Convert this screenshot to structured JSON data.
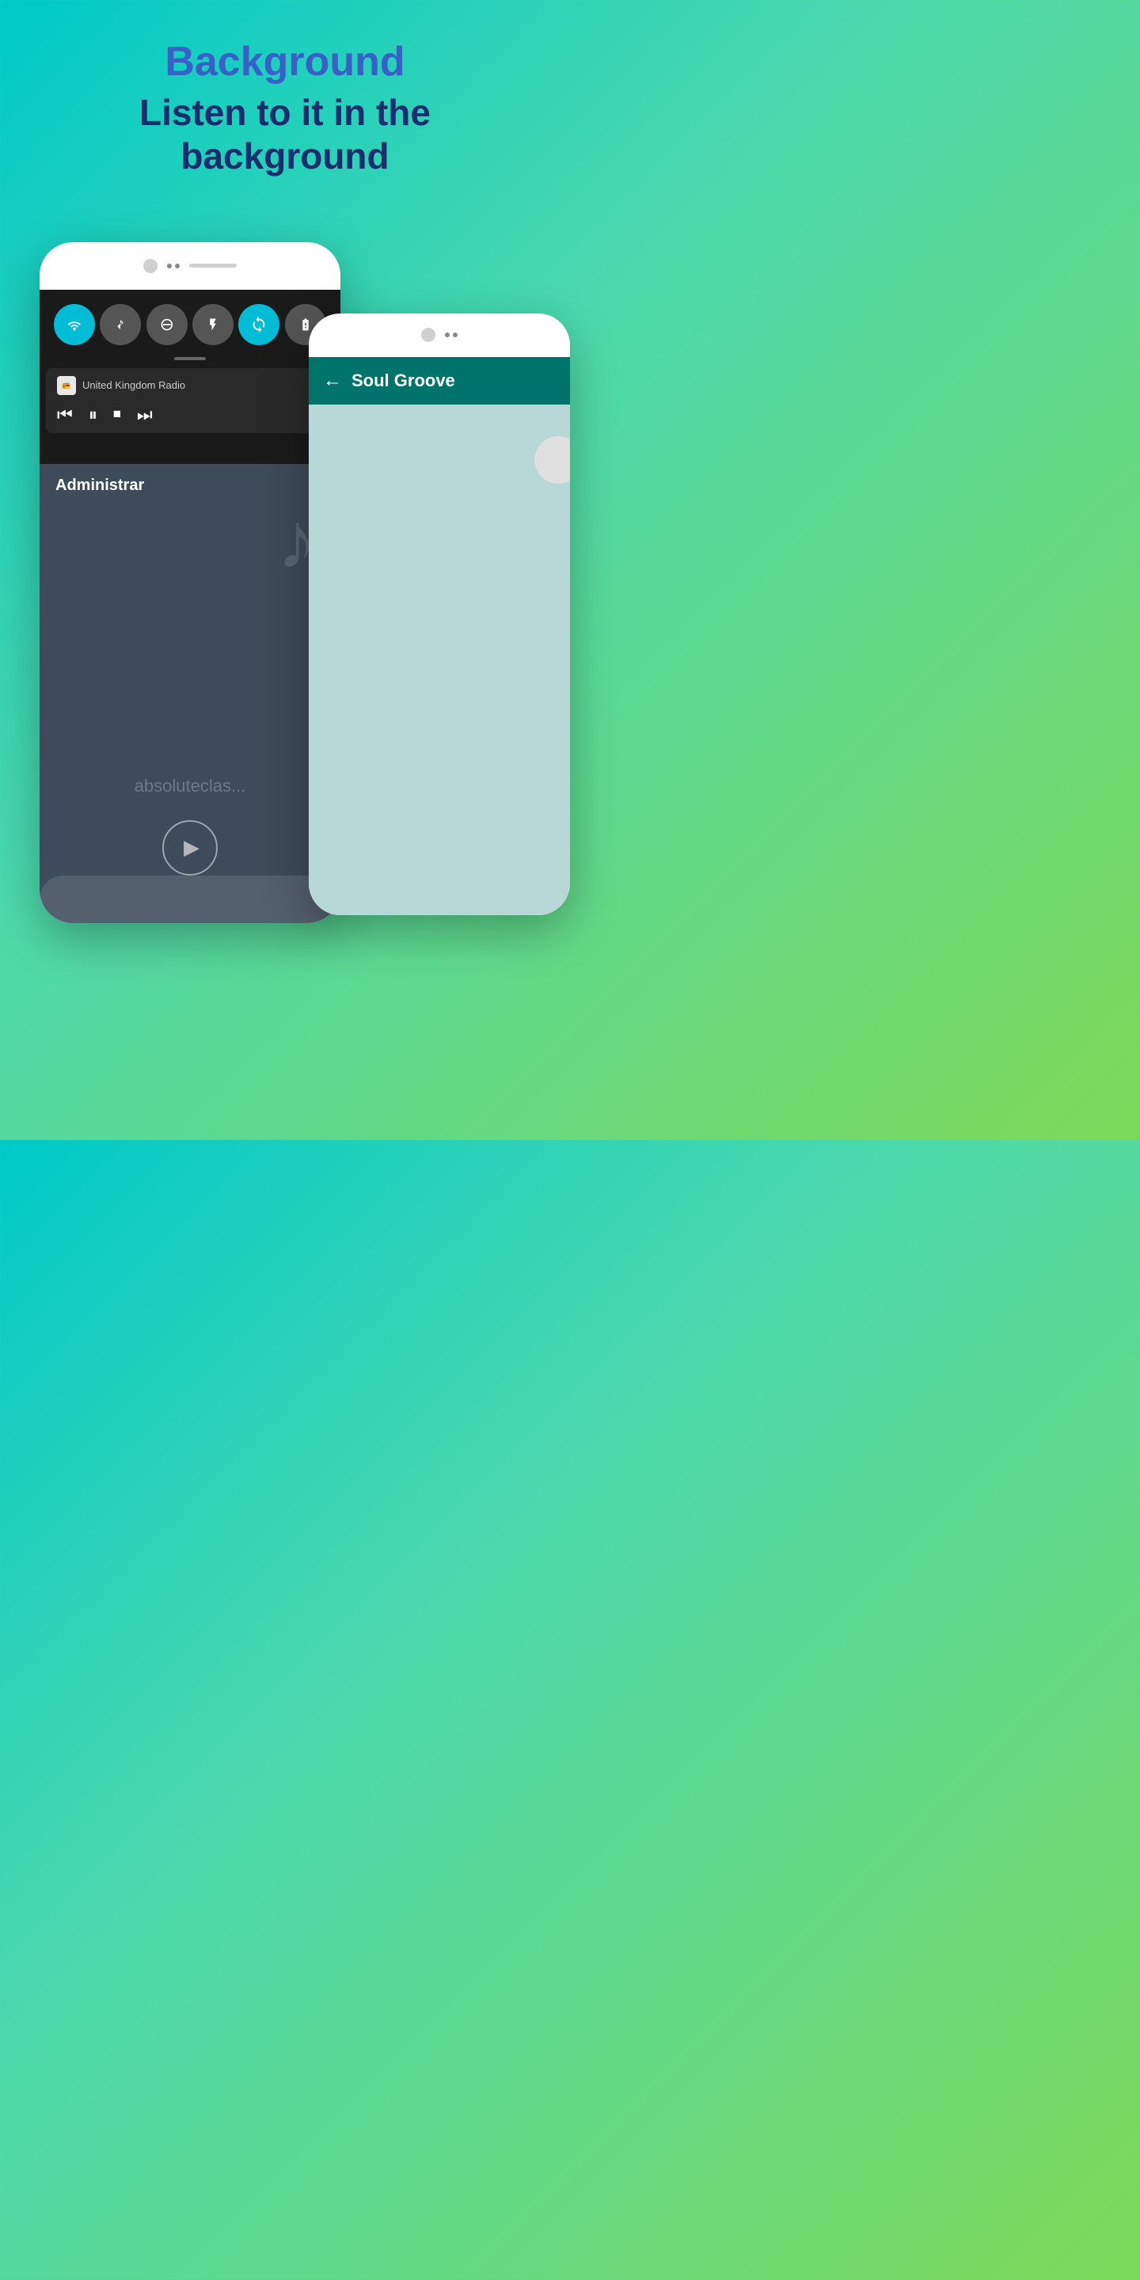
{
  "header": {
    "title": "Background",
    "subtitle_line1": "Listen to it in the",
    "subtitle_line2": "background"
  },
  "phone_left": {
    "media_app_name": "United Kingdom Radio",
    "manage_label": "Administrar",
    "watermark": "absoluteclas...",
    "controls": {
      "prev": "⏮",
      "pause": "⏸",
      "stop": "⏹",
      "next": "⏭"
    }
  },
  "phone_right": {
    "station_name": "Soul Groove",
    "back_arrow": "←"
  },
  "quick_icons": [
    {
      "id": "wifi",
      "active": true,
      "symbol": "▼"
    },
    {
      "id": "bluetooth",
      "active": false,
      "symbol": "✦"
    },
    {
      "id": "dnd",
      "active": false,
      "symbol": "⊖"
    },
    {
      "id": "flashlight",
      "active": false,
      "symbol": "🔦"
    },
    {
      "id": "sync",
      "active": true,
      "symbol": "↻"
    },
    {
      "id": "battery",
      "active": false,
      "symbol": "⚡"
    }
  ]
}
